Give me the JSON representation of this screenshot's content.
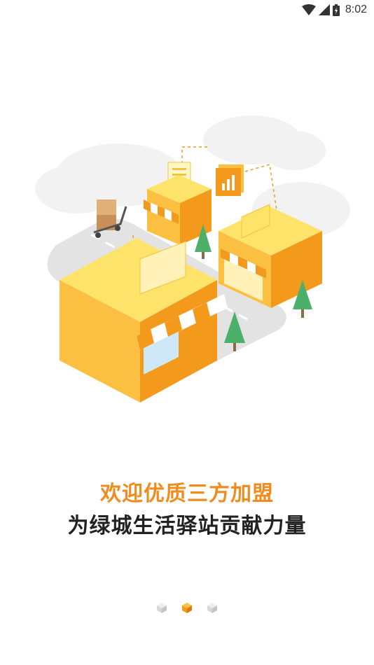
{
  "status_bar": {
    "time": "8:02",
    "icons": [
      "wifi-icon",
      "signal-icon",
      "battery-icon"
    ]
  },
  "onboarding": {
    "headline": "欢迎优质三方加盟",
    "subline": "为绿城生活驿站贡献力量",
    "pages_total": 3,
    "current_page": 2
  },
  "colors": {
    "accent": "#f08c1e",
    "text_dark": "#222222",
    "dot_inactive": "#d8d8d8",
    "dot_active": "#f39a1c"
  }
}
